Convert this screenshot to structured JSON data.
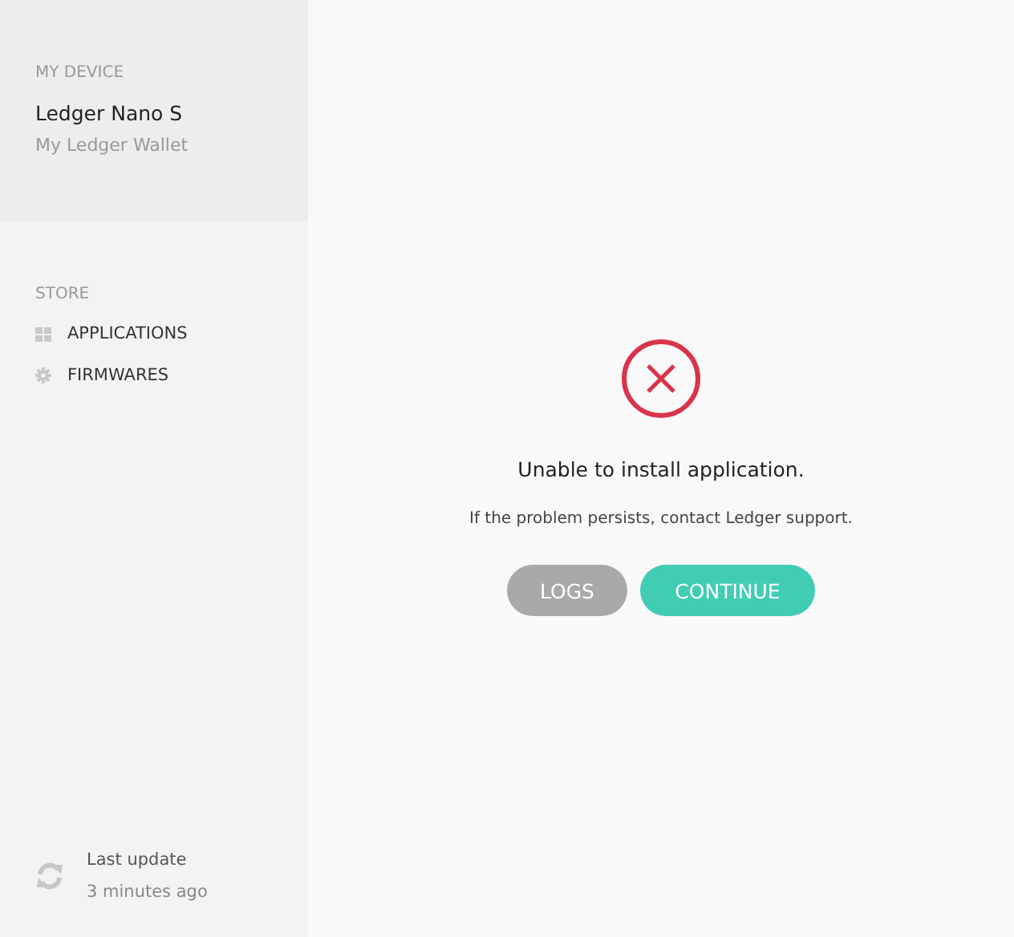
{
  "sidebar": {
    "device_heading": "MY DEVICE",
    "device_name": "Ledger Nano S",
    "device_subtitle": "My Ledger Wallet",
    "store_heading": "STORE",
    "items": [
      {
        "label": "APPLICATIONS",
        "kind": "grid"
      },
      {
        "label": "FIRMWARES",
        "kind": "gear"
      }
    ],
    "update": {
      "title": "Last update",
      "time": "3 minutes ago"
    }
  },
  "dialog": {
    "message": "Unable to install application.",
    "hint": "If the problem persists, contact Ledger support.",
    "buttons": [
      {
        "label": "LOGS",
        "kind": "secondary"
      },
      {
        "label": "CONTINUE",
        "kind": "primary"
      }
    ]
  }
}
